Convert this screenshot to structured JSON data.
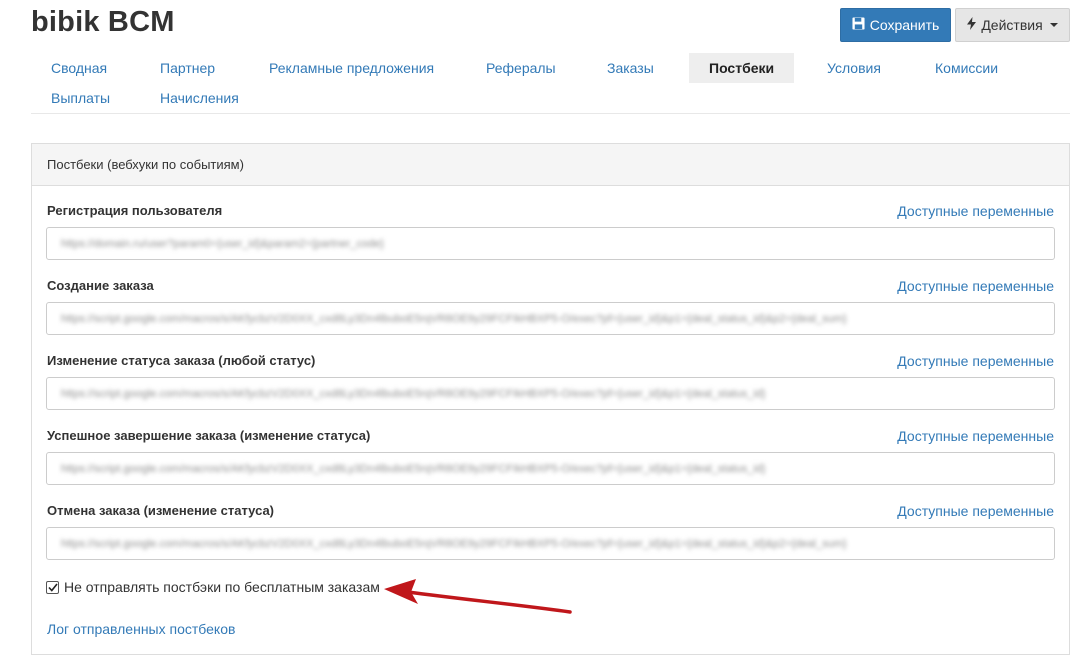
{
  "header": {
    "title": "bibik BCM",
    "save_label": "Сохранить",
    "actions_label": "Действия"
  },
  "tabs": [
    {
      "label": "Сводная"
    },
    {
      "label": "Партнер"
    },
    {
      "label": "Рекламные предложения"
    },
    {
      "label": "Рефералы"
    },
    {
      "label": "Заказы"
    },
    {
      "label": "Постбеки",
      "active": true
    },
    {
      "label": "Условия"
    },
    {
      "label": "Комиссии"
    },
    {
      "label": "Выплаты"
    },
    {
      "label": "Начисления"
    }
  ],
  "panel": {
    "heading": "Постбеки (вебхуки по событиям)",
    "fields": [
      {
        "label": "Регистрация пользователя",
        "link": "Доступные переменные",
        "value": "https://domain.ru/user?param0={user_id}&param2={partner_code}"
      },
      {
        "label": "Создание заказа",
        "link": "Доступные переменные",
        "value": "https://script.google.com/macros/s/AKfycbzV2D0XX_cxd8Ly3Dn4lbuboE5rqVR8OE9y29FCFIkHBXP5-O/exec?pf={user_id}&p1={deal_status_id}&p2={deal_sum}"
      },
      {
        "label": "Изменение статуса заказа (любой статус)",
        "link": "Доступные переменные",
        "value": "https://script.google.com/macros/s/AKfycbzV2D0XX_cxd8Ly3Dn4lbuboE5rqVR8OE9y29FCFIkHBXP5-O/exec?pf={user_id}&p1={deal_status_id}"
      },
      {
        "label": "Успешное завершение заказа (изменение статуса)",
        "link": "Доступные переменные",
        "value": "https://script.google.com/macros/s/AKfycbzV2D0XX_cxd8Ly3Dn4lbuboE5rqVR8OE9y29FCFIkHBXP5-O/exec?pf={user_id}&p1={deal_status_id}"
      },
      {
        "label": "Отмена заказа (изменение статуса)",
        "link": "Доступные переменные",
        "value": "https://script.google.com/macros/s/AKfycbzV2D0XX_cxd8Ly3Dn4lbuboE5rqVR8OE9y29FCFIkHBXP5-O/exec?pf={user_id}&p1={deal_status_id}&p2={deal_sum}"
      }
    ],
    "checkbox": {
      "label": "Не отправлять постбэки по бесплатным заказам",
      "checked": true
    },
    "log_link": "Лог отправленных постбеков"
  },
  "colors": {
    "primary": "#337ab7",
    "arrow": "#c0171b"
  },
  "icons": {
    "save": "floppy-disk-icon",
    "actions": "lightning-icon",
    "dropdown": "caret-down-icon"
  }
}
